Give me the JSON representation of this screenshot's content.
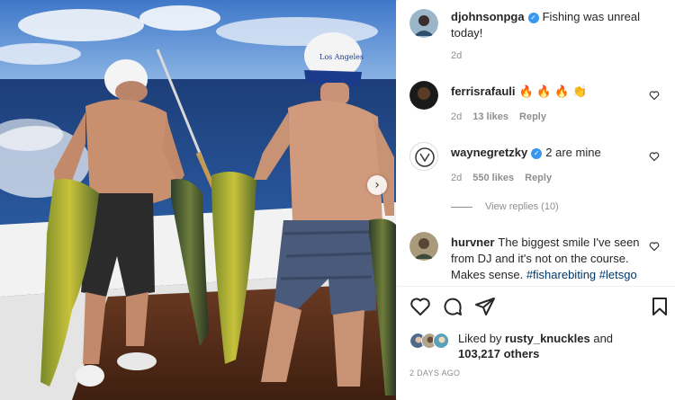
{
  "post": {
    "author": "djohnsonpga",
    "caption": "Fishing was unreal today!",
    "age": "2d",
    "cap_text": "Los Angeles"
  },
  "comments": [
    {
      "user": "ferrisrafauli",
      "text": "🔥 🔥 🔥 👏",
      "age": "2d",
      "likes": "13 likes",
      "reply": "Reply",
      "verified": false
    },
    {
      "user": "waynegretzky",
      "text": "2 are mine",
      "age": "2d",
      "likes": "550 likes",
      "reply": "Reply",
      "verified": true
    },
    {
      "user": "hurvner",
      "text": "The biggest smile I've seen from DJ and it's not on the course. Makes sense.",
      "hashtags": "#fisharebiting #letsgo",
      "verified": false
    }
  ],
  "view_replies": "View replies (10)",
  "actions": {
    "like": "heart-icon",
    "comment": "comment-icon",
    "share": "share-icon",
    "save": "bookmark-icon"
  },
  "liked_by": {
    "prefix": "Liked by",
    "user": "rusty_knuckles",
    "middle": "and",
    "count": "103,217 others"
  },
  "timestamp": "2 DAYS AGO",
  "colors": {
    "verified": "#3897f0",
    "hashtag": "#00376b",
    "muted": "#8e8e8e"
  }
}
